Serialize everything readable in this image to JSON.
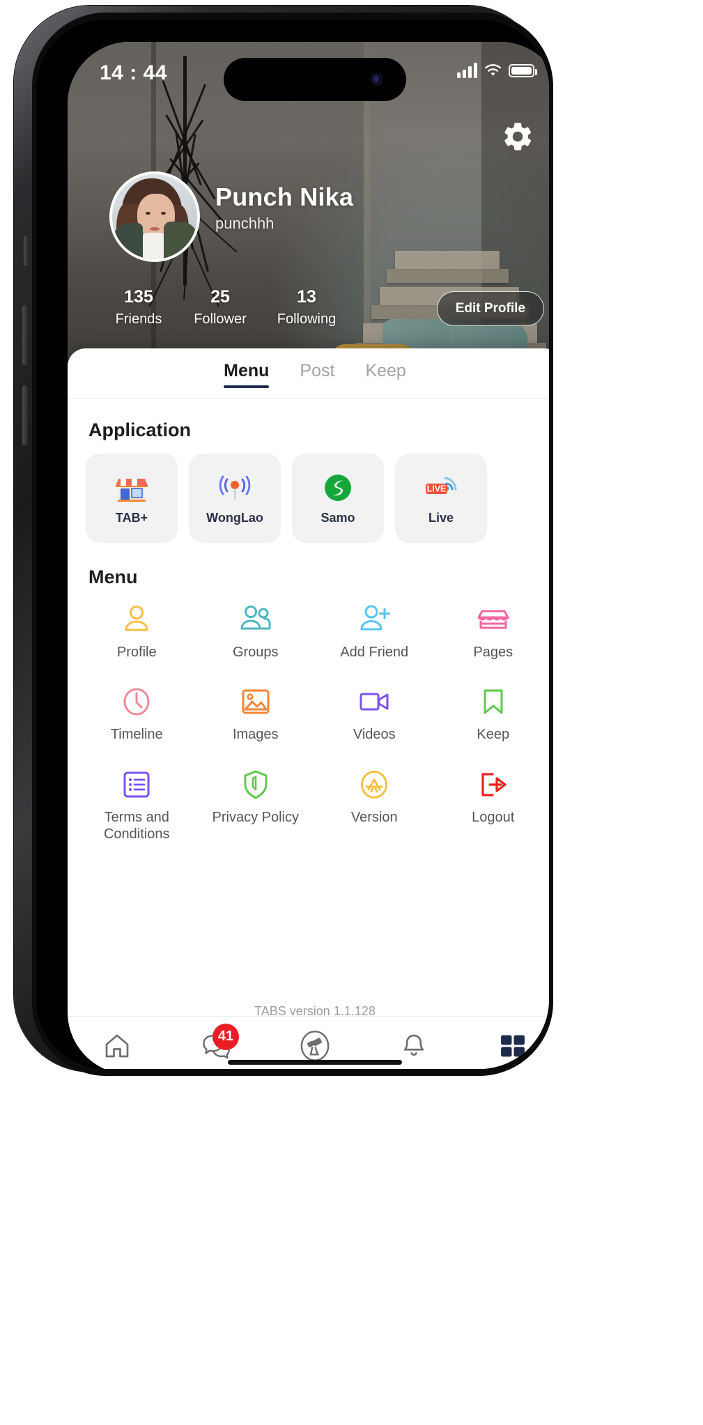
{
  "status_bar": {
    "time": "14 : 44",
    "signal_icon": "cellular-bars-icon",
    "wifi_icon": "wifi-icon",
    "battery_icon": "battery-full-icon"
  },
  "header": {
    "settings_icon": "gear-icon",
    "avatar_alt": "avatar",
    "name": "Punch Nika",
    "handle": "punchhh",
    "edit_button": "Edit Profile",
    "stats": [
      {
        "value": "135",
        "label": "Friends"
      },
      {
        "value": "25",
        "label": "Follower"
      },
      {
        "value": "13",
        "label": "Following"
      }
    ]
  },
  "tabs": [
    {
      "label": "Menu",
      "active": true
    },
    {
      "label": "Post",
      "active": false
    },
    {
      "label": "Keep",
      "active": false
    }
  ],
  "application": {
    "title": "Application",
    "items": [
      {
        "label": "TAB+",
        "icon": "storefront-icon"
      },
      {
        "label": "WongLao",
        "icon": "broadcast-icon"
      },
      {
        "label": "Samo",
        "icon": "samo-logo-icon"
      },
      {
        "label": "Live",
        "icon": "live-broadcast-icon"
      }
    ]
  },
  "menu": {
    "title": "Menu",
    "items": [
      {
        "label": "Profile",
        "icon": "user-icon",
        "color": "#f7bf44"
      },
      {
        "label": "Groups",
        "icon": "users-group-icon",
        "color": "#4cb7bd"
      },
      {
        "label": "Add Friend",
        "icon": "user-plus-icon",
        "color": "#55c5f2"
      },
      {
        "label": "Pages",
        "icon": "store-awning-icon",
        "color": "#f368a0"
      },
      {
        "label": "Timeline",
        "icon": "clock-icon",
        "color": "#f0889a"
      },
      {
        "label": "Images",
        "icon": "photo-icon",
        "color": "#f58634"
      },
      {
        "label": "Videos",
        "icon": "video-camera-icon",
        "color": "#7a52f4"
      },
      {
        "label": "Keep",
        "icon": "bookmark-icon",
        "color": "#5ec94b"
      },
      {
        "label": "Terms and Conditions",
        "icon": "list-document-icon",
        "color": "#7a52f4"
      },
      {
        "label": "Privacy Policy",
        "icon": "shield-icon",
        "color": "#5ec94b"
      },
      {
        "label": "Version",
        "icon": "app-store-icon",
        "color": "#f7bf44"
      },
      {
        "label": "Logout",
        "icon": "logout-arrow-icon",
        "color": "#f01f1f"
      }
    ]
  },
  "footer": {
    "version_text": "TABS version 1.1.128"
  },
  "bottom_nav": [
    {
      "icon": "home-icon",
      "badge": null,
      "active": false
    },
    {
      "icon": "chat-bubbles-icon",
      "badge": "41",
      "active": false
    },
    {
      "icon": "discover-telescope-icon",
      "badge": null,
      "active": false
    },
    {
      "icon": "bell-icon",
      "badge": null,
      "active": false
    },
    {
      "icon": "grid-squares-icon",
      "badge": null,
      "active": true
    }
  ],
  "colors": {
    "accent": "#1d2a4a",
    "badge": "#ec1c24",
    "tile_bg": "#f2f2f3",
    "muted_text": "#9e9e9e"
  }
}
